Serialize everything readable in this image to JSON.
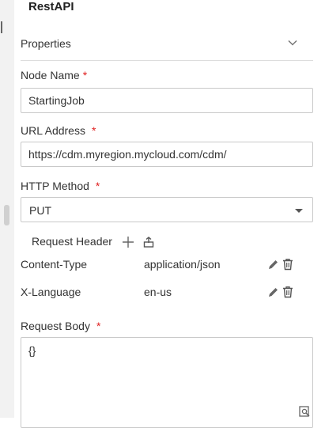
{
  "panel": {
    "title": "RestAPI"
  },
  "section": {
    "title": "Properties",
    "icon": "chevron-down-icon"
  },
  "fields": {
    "node_name": {
      "label": "Node Name",
      "required_mark": "*",
      "value": "StartingJob"
    },
    "url_address": {
      "label": "URL Address",
      "required_mark": "*",
      "value": "https://cdm.myregion.mycloud.com/cdm/"
    },
    "http_method": {
      "label": "HTTP Method",
      "required_mark": "*",
      "value": "PUT"
    },
    "request_body": {
      "label": "Request Body",
      "required_mark": "*",
      "value": "{}"
    }
  },
  "request_header": {
    "label": "Request Header",
    "add_icon": "plus-icon",
    "import_icon": "import-icon",
    "rows": [
      {
        "key": "Content-Type",
        "value": "application/json"
      },
      {
        "key": "X-Language",
        "value": "en-us"
      }
    ],
    "row_icons": [
      "edit-icon",
      "delete-icon"
    ]
  },
  "colors": {
    "required": "#e02020",
    "border": "#c9c9c9",
    "text": "#333333",
    "sidebar": "#f2f2f2"
  }
}
